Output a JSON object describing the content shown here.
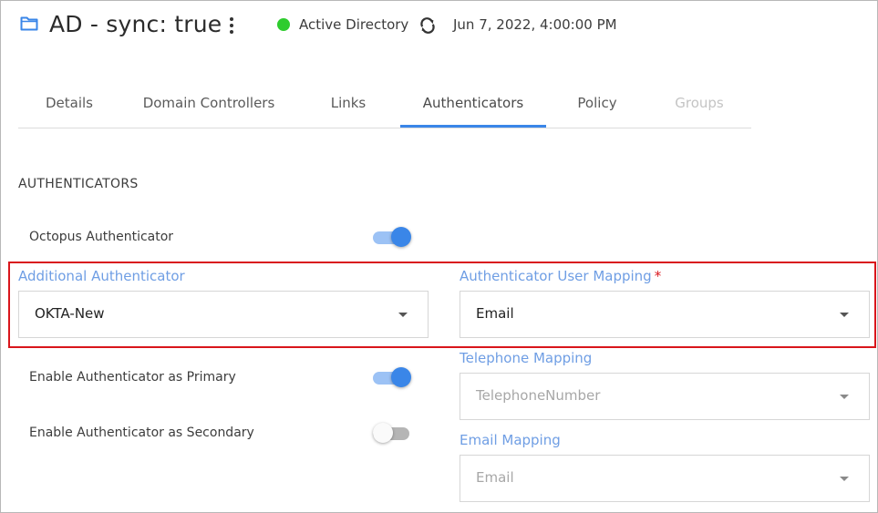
{
  "header": {
    "title": "AD - sync: true",
    "status_text": "Active Directory",
    "status_color": "#2ecc2e",
    "timestamp": "Jun 7, 2022, 4:00:00 PM",
    "icons": [
      "folder-icon",
      "more-vert-icon",
      "sync-icon"
    ]
  },
  "tabs": [
    {
      "label": "Details",
      "state": "normal"
    },
    {
      "label": "Domain Controllers",
      "state": "normal"
    },
    {
      "label": "Links",
      "state": "normal"
    },
    {
      "label": "Authenticators",
      "state": "active"
    },
    {
      "label": "Policy",
      "state": "normal"
    },
    {
      "label": "Groups",
      "state": "disabled"
    }
  ],
  "section": {
    "heading": "AUTHENTICATORS",
    "octopus_authenticator": {
      "label": "Octopus Authenticator",
      "enabled": true
    },
    "enable_primary": {
      "label": "Enable Authenticator as Primary",
      "enabled": true
    },
    "enable_secondary": {
      "label": "Enable Authenticator as Secondary",
      "enabled": false
    }
  },
  "fields": {
    "additional_authenticator": {
      "label": "Additional Authenticator",
      "value": "OKTA-New"
    },
    "user_mapping": {
      "label": "Authenticator User Mapping",
      "required_mark": "*",
      "value": "Email"
    },
    "telephone_mapping": {
      "label": "Telephone Mapping",
      "value": "TelephoneNumber"
    },
    "email_mapping": {
      "label": "Email Mapping",
      "value": "Email"
    }
  },
  "colors": {
    "accent": "#3a86e8",
    "label_blue": "#6f9ee4",
    "highlight": "#d9161c"
  }
}
